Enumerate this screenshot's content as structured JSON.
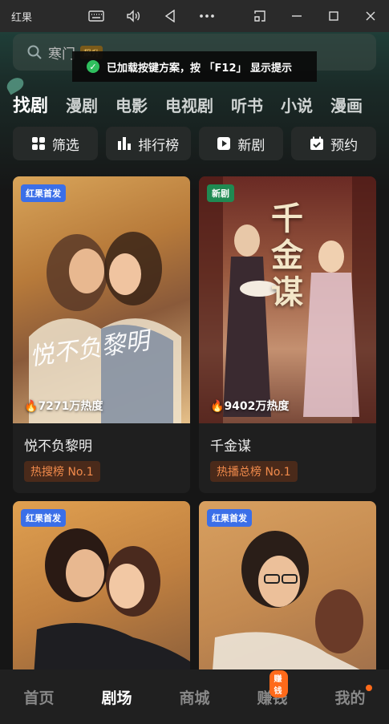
{
  "window": {
    "title": "红果"
  },
  "search": {
    "placeholder": "寒门",
    "hot_tag": "飙升"
  },
  "toast": {
    "text": "已加载按键方案，按 「F12」 显示提示"
  },
  "categories": [
    "找剧",
    "漫剧",
    "电影",
    "电视剧",
    "听书",
    "小说",
    "漫画"
  ],
  "actions": [
    {
      "label": "筛选",
      "icon": "grid-icon"
    },
    {
      "label": "排行榜",
      "icon": "bar-chart-icon"
    },
    {
      "label": "新剧",
      "icon": "play-icon"
    },
    {
      "label": "预约",
      "icon": "calendar-check-icon"
    }
  ],
  "cards": [
    {
      "title": "悦不负黎明",
      "badge": "红果首发",
      "badge_color": "#3b6fe8",
      "heat": "7271万热度",
      "rank": "热搜榜 No.1",
      "poster_art": "悦不负黎明"
    },
    {
      "title": "千金谋",
      "badge": "新剧",
      "badge_color": "#1f8a52",
      "heat": "9402万热度",
      "rank": "热播总榜 No.1",
      "poster_art": "千金谋"
    },
    {
      "title": "",
      "badge": "红果首发",
      "badge_color": "#3b6fe8",
      "heat": "",
      "rank": ""
    },
    {
      "title": "",
      "badge": "红果首发",
      "badge_color": "#3b6fe8",
      "heat": "",
      "rank": ""
    }
  ],
  "tabs": [
    {
      "label": "首页"
    },
    {
      "label": "剧场",
      "active": true
    },
    {
      "label": "商城"
    },
    {
      "label": "赚钱",
      "pill": "赚钱"
    },
    {
      "label": "我的",
      "dot": true
    }
  ]
}
